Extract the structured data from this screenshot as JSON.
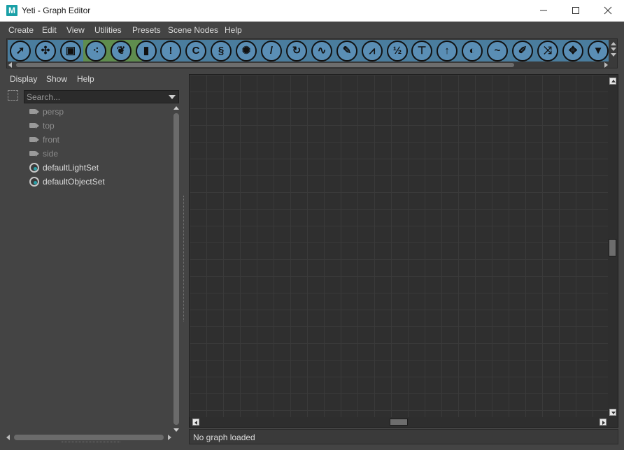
{
  "window": {
    "app_icon_letter": "M",
    "title": "Yeti - Graph Editor",
    "controls": {
      "minimize": "minimize",
      "maximize": "maximize",
      "close": "close"
    }
  },
  "menubar": {
    "items": [
      "Create",
      "Edit",
      "View",
      "Utilities",
      "Presets",
      "Scene Nodes",
      "Help"
    ]
  },
  "shelf": {
    "colors": {
      "blue": "#4a7d9e",
      "green": "#5f8d4e"
    },
    "tools": [
      {
        "icon": "arrow-select-icon",
        "glyph": "➚"
      },
      {
        "icon": "puzzle-icon",
        "glyph": "✣"
      },
      {
        "icon": "archive-box-icon",
        "glyph": "▣"
      },
      {
        "icon": "three-dots-icon",
        "glyph": "⁖"
      },
      {
        "icon": "leaves-icon",
        "glyph": "❦"
      },
      {
        "icon": "cylinder-icon",
        "glyph": "▮"
      },
      {
        "icon": "exclamation-icon",
        "glyph": "!"
      },
      {
        "icon": "curve-c-icon",
        "glyph": "C"
      },
      {
        "icon": "spring-icon",
        "glyph": "§"
      },
      {
        "icon": "fur-icon",
        "glyph": "✺"
      },
      {
        "icon": "comb-icon",
        "glyph": "/"
      },
      {
        "icon": "rotate-icon",
        "glyph": "↻"
      },
      {
        "icon": "squiggle-icon",
        "glyph": "∿"
      },
      {
        "icon": "brush-icon",
        "glyph": "✎"
      },
      {
        "icon": "noise-peaks-icon",
        "glyph": "⩘"
      },
      {
        "icon": "one-half-icon",
        "glyph": "½"
      },
      {
        "icon": "signpost-icon",
        "glyph": "⊤"
      },
      {
        "icon": "up-arrow-icon",
        "glyph": "↑"
      },
      {
        "icon": "moon-icon",
        "glyph": "◐"
      },
      {
        "icon": "wave-icon",
        "glyph": "~"
      },
      {
        "icon": "pen-icon",
        "glyph": "✐"
      },
      {
        "icon": "shuffle-icon",
        "glyph": "⤨"
      },
      {
        "icon": "move-icon",
        "glyph": "✥"
      },
      {
        "icon": "filter-funnel-icon",
        "glyph": "▼"
      }
    ]
  },
  "outliner_panel": {
    "menu": [
      "Display",
      "Show",
      "Help"
    ],
    "search": {
      "placeholder": "Search...",
      "value": ""
    },
    "items": [
      {
        "label": "persp",
        "type": "camera",
        "dim": true
      },
      {
        "label": "top",
        "type": "camera",
        "dim": true
      },
      {
        "label": "front",
        "type": "camera",
        "dim": true
      },
      {
        "label": "side",
        "type": "camera",
        "dim": true
      },
      {
        "label": "defaultLightSet",
        "type": "set",
        "dim": false
      },
      {
        "label": "defaultObjectSet",
        "type": "set",
        "dim": false
      }
    ]
  },
  "graph": {
    "status": "No graph loaded"
  }
}
